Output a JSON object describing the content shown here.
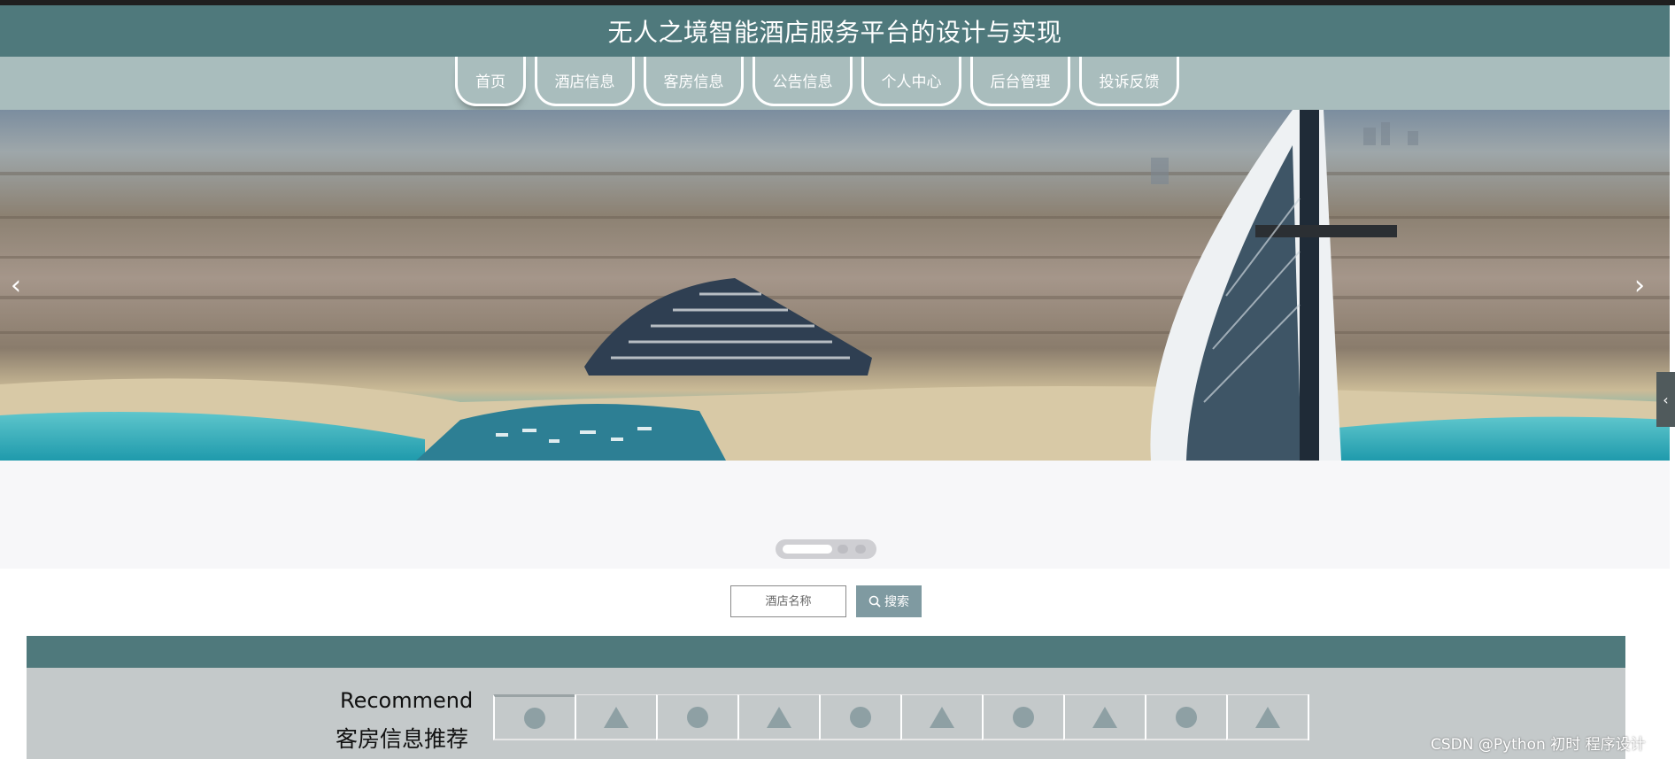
{
  "header": {
    "title": "无人之境智能酒店服务平台的设计与实现"
  },
  "nav": {
    "items": [
      {
        "label": "首页"
      },
      {
        "label": "酒店信息"
      },
      {
        "label": "客房信息"
      },
      {
        "label": "公告信息"
      },
      {
        "label": "个人中心"
      },
      {
        "label": "后台管理"
      },
      {
        "label": "投诉反馈"
      }
    ]
  },
  "banner": {
    "prev_icon": "chevron-left-icon",
    "next_icon": "chevron-right-icon",
    "slide_count": 3,
    "active_index": 0
  },
  "search": {
    "placeholder": "酒店名称",
    "button_label": "搜索",
    "icon": "search-icon"
  },
  "recommend": {
    "title_en": "Recommend",
    "title_cn": "客房信息推荐",
    "tiles": [
      "circle",
      "triangle",
      "circle",
      "triangle",
      "circle",
      "triangle",
      "circle",
      "triangle",
      "circle",
      "triangle"
    ]
  },
  "side_tab": {
    "icon": "chevron-left-icon"
  },
  "watermark": "CSDN @Python 初时 程序设计",
  "colors": {
    "header_bg": "#4f797c",
    "nav_bg": "#a9bdbd",
    "button_bg": "#7f9aa1",
    "section_body_bg": "#c4c9ca"
  }
}
